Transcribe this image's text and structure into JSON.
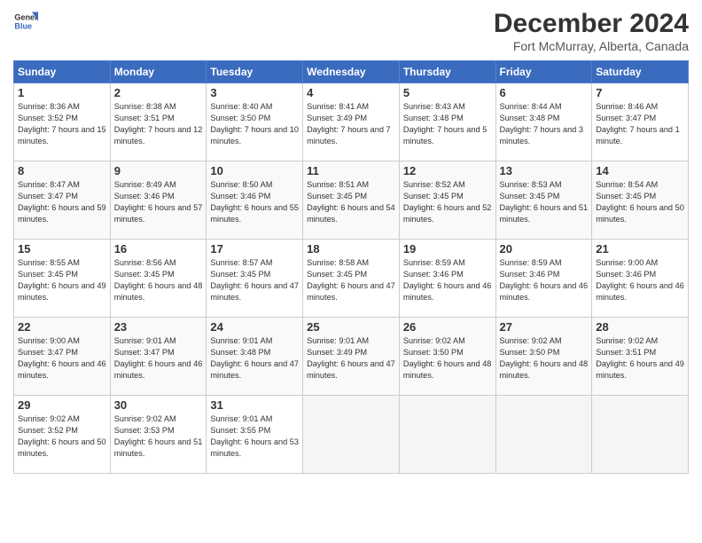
{
  "header": {
    "logo_line1": "General",
    "logo_line2": "Blue",
    "month": "December 2024",
    "location": "Fort McMurray, Alberta, Canada"
  },
  "days_of_week": [
    "Sunday",
    "Monday",
    "Tuesday",
    "Wednesday",
    "Thursday",
    "Friday",
    "Saturday"
  ],
  "weeks": [
    [
      {
        "day": "1",
        "sunrise": "8:36 AM",
        "sunset": "3:52 PM",
        "daylight": "7 hours and 15 minutes."
      },
      {
        "day": "2",
        "sunrise": "8:38 AM",
        "sunset": "3:51 PM",
        "daylight": "7 hours and 12 minutes."
      },
      {
        "day": "3",
        "sunrise": "8:40 AM",
        "sunset": "3:50 PM",
        "daylight": "7 hours and 10 minutes."
      },
      {
        "day": "4",
        "sunrise": "8:41 AM",
        "sunset": "3:49 PM",
        "daylight": "7 hours and 7 minutes."
      },
      {
        "day": "5",
        "sunrise": "8:43 AM",
        "sunset": "3:48 PM",
        "daylight": "7 hours and 5 minutes."
      },
      {
        "day": "6",
        "sunrise": "8:44 AM",
        "sunset": "3:48 PM",
        "daylight": "7 hours and 3 minutes."
      },
      {
        "day": "7",
        "sunrise": "8:46 AM",
        "sunset": "3:47 PM",
        "daylight": "7 hours and 1 minute."
      }
    ],
    [
      {
        "day": "8",
        "sunrise": "8:47 AM",
        "sunset": "3:47 PM",
        "daylight": "6 hours and 59 minutes."
      },
      {
        "day": "9",
        "sunrise": "8:49 AM",
        "sunset": "3:46 PM",
        "daylight": "6 hours and 57 minutes."
      },
      {
        "day": "10",
        "sunrise": "8:50 AM",
        "sunset": "3:46 PM",
        "daylight": "6 hours and 55 minutes."
      },
      {
        "day": "11",
        "sunrise": "8:51 AM",
        "sunset": "3:45 PM",
        "daylight": "6 hours and 54 minutes."
      },
      {
        "day": "12",
        "sunrise": "8:52 AM",
        "sunset": "3:45 PM",
        "daylight": "6 hours and 52 minutes."
      },
      {
        "day": "13",
        "sunrise": "8:53 AM",
        "sunset": "3:45 PM",
        "daylight": "6 hours and 51 minutes."
      },
      {
        "day": "14",
        "sunrise": "8:54 AM",
        "sunset": "3:45 PM",
        "daylight": "6 hours and 50 minutes."
      }
    ],
    [
      {
        "day": "15",
        "sunrise": "8:55 AM",
        "sunset": "3:45 PM",
        "daylight": "6 hours and 49 minutes."
      },
      {
        "day": "16",
        "sunrise": "8:56 AM",
        "sunset": "3:45 PM",
        "daylight": "6 hours and 48 minutes."
      },
      {
        "day": "17",
        "sunrise": "8:57 AM",
        "sunset": "3:45 PM",
        "daylight": "6 hours and 47 minutes."
      },
      {
        "day": "18",
        "sunrise": "8:58 AM",
        "sunset": "3:45 PM",
        "daylight": "6 hours and 47 minutes."
      },
      {
        "day": "19",
        "sunrise": "8:59 AM",
        "sunset": "3:46 PM",
        "daylight": "6 hours and 46 minutes."
      },
      {
        "day": "20",
        "sunrise": "8:59 AM",
        "sunset": "3:46 PM",
        "daylight": "6 hours and 46 minutes."
      },
      {
        "day": "21",
        "sunrise": "9:00 AM",
        "sunset": "3:46 PM",
        "daylight": "6 hours and 46 minutes."
      }
    ],
    [
      {
        "day": "22",
        "sunrise": "9:00 AM",
        "sunset": "3:47 PM",
        "daylight": "6 hours and 46 minutes."
      },
      {
        "day": "23",
        "sunrise": "9:01 AM",
        "sunset": "3:47 PM",
        "daylight": "6 hours and 46 minutes."
      },
      {
        "day": "24",
        "sunrise": "9:01 AM",
        "sunset": "3:48 PM",
        "daylight": "6 hours and 47 minutes."
      },
      {
        "day": "25",
        "sunrise": "9:01 AM",
        "sunset": "3:49 PM",
        "daylight": "6 hours and 47 minutes."
      },
      {
        "day": "26",
        "sunrise": "9:02 AM",
        "sunset": "3:50 PM",
        "daylight": "6 hours and 48 minutes."
      },
      {
        "day": "27",
        "sunrise": "9:02 AM",
        "sunset": "3:50 PM",
        "daylight": "6 hours and 48 minutes."
      },
      {
        "day": "28",
        "sunrise": "9:02 AM",
        "sunset": "3:51 PM",
        "daylight": "6 hours and 49 minutes."
      }
    ],
    [
      {
        "day": "29",
        "sunrise": "9:02 AM",
        "sunset": "3:52 PM",
        "daylight": "6 hours and 50 minutes."
      },
      {
        "day": "30",
        "sunrise": "9:02 AM",
        "sunset": "3:53 PM",
        "daylight": "6 hours and 51 minutes."
      },
      {
        "day": "31",
        "sunrise": "9:01 AM",
        "sunset": "3:55 PM",
        "daylight": "6 hours and 53 minutes."
      },
      {
        "day": "",
        "sunrise": "",
        "sunset": "",
        "daylight": ""
      },
      {
        "day": "",
        "sunrise": "",
        "sunset": "",
        "daylight": ""
      },
      {
        "day": "",
        "sunrise": "",
        "sunset": "",
        "daylight": ""
      },
      {
        "day": "",
        "sunrise": "",
        "sunset": "",
        "daylight": ""
      }
    ]
  ]
}
